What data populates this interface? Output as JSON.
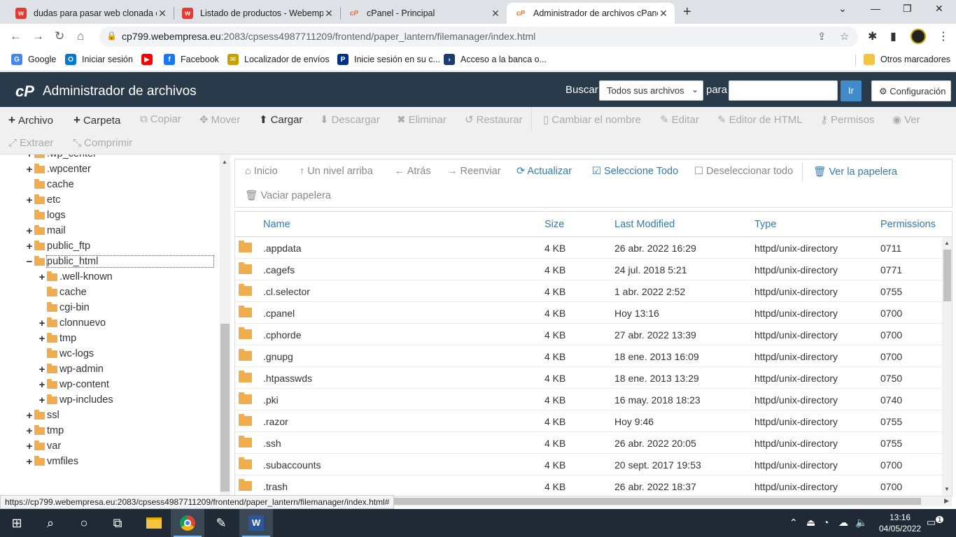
{
  "browser": {
    "tabs": [
      {
        "title": "dudas para pasar web clonada co",
        "favicon_color": "#e53935",
        "favicon_glyph": "w",
        "active": false
      },
      {
        "title": "Listado de productos - Webempr",
        "favicon_color": "#e53935",
        "favicon_glyph": "w",
        "active": false
      },
      {
        "title": "cPanel - Principal",
        "favicon_color": "#ff6c2c",
        "favicon_glyph": "cP",
        "active": false
      },
      {
        "title": "Administrador de archivos cPanel",
        "favicon_color": "#ff6c2c",
        "favicon_glyph": "cP",
        "active": true
      }
    ],
    "url_domain": "cp799.webempresa.eu",
    "url_rest": ":2083/cpsess4987711209/frontend/paper_lantern/filemanager/index.html",
    "bookmarks": [
      {
        "label": "Google",
        "icon_color": "#4285f4",
        "glyph": "G"
      },
      {
        "label": "Iniciar sesión",
        "icon_color": "#0078d4",
        "glyph": "O"
      },
      {
        "label": "",
        "icon_color": "#ff0000",
        "glyph": "▶"
      },
      {
        "label": "Facebook",
        "icon_color": "#1877f2",
        "glyph": "f"
      },
      {
        "label": "Localizador de envíos",
        "icon_color": "#c8a000",
        "glyph": "✉"
      },
      {
        "label": "Inicie sesión en su c...",
        "icon_color": "#003087",
        "glyph": "P"
      },
      {
        "label": "Acceso a la banca o...",
        "icon_color": "#1c3c6e",
        "glyph": "›"
      }
    ],
    "other_bookmarks": "Otros marcadores"
  },
  "header": {
    "logo": "cP",
    "title": "Administrador de archivos",
    "search_label": "Buscar",
    "search_scope": "Todos sus archivos",
    "for_label": "para",
    "go_label": "Ir",
    "settings_label": "Configuración"
  },
  "toolbar": [
    {
      "label": "Archivo",
      "icon": "+",
      "enabled": true
    },
    {
      "label": "Carpeta",
      "icon": "+",
      "enabled": true
    },
    {
      "label": "Copiar",
      "icon": "⧉",
      "enabled": false
    },
    {
      "label": "Mover",
      "icon": "✥",
      "enabled": false
    },
    {
      "label": "Cargar",
      "icon": "⬆",
      "enabled": true
    },
    {
      "label": "Descargar",
      "icon": "⬇",
      "enabled": false
    },
    {
      "label": "Eliminar",
      "icon": "✖",
      "enabled": false
    },
    {
      "label": "Restaurar",
      "icon": "↺",
      "enabled": false
    },
    {
      "label": "Cambiar el nombre",
      "icon": "▯",
      "enabled": false
    },
    {
      "label": "Editar",
      "icon": "✎",
      "enabled": false
    },
    {
      "label": "Editor de HTML",
      "icon": "✎",
      "enabled": false
    },
    {
      "label": "Permisos",
      "icon": "⚷",
      "enabled": false
    },
    {
      "label": "Ver",
      "icon": "◉",
      "enabled": false
    },
    {
      "label": "Extraer",
      "icon": "⤢",
      "enabled": false
    },
    {
      "label": "Comprimir",
      "icon": "⤡",
      "enabled": false
    }
  ],
  "tree": [
    {
      "label": ".wp_center",
      "toggle": "+",
      "depth": 0
    },
    {
      "label": ".wpcenter",
      "toggle": "+",
      "depth": 0
    },
    {
      "label": "cache",
      "toggle": "",
      "depth": 0
    },
    {
      "label": "etc",
      "toggle": "+",
      "depth": 0
    },
    {
      "label": "logs",
      "toggle": "",
      "depth": 0
    },
    {
      "label": "mail",
      "toggle": "+",
      "depth": 0
    },
    {
      "label": "public_ftp",
      "toggle": "+",
      "depth": 0
    },
    {
      "label": "public_html",
      "toggle": "−",
      "depth": 0,
      "selected": true
    },
    {
      "label": ".well-known",
      "toggle": "+",
      "depth": 1
    },
    {
      "label": "cache",
      "toggle": "",
      "depth": 1
    },
    {
      "label": "cgi-bin",
      "toggle": "",
      "depth": 1
    },
    {
      "label": "clonnuevo",
      "toggle": "+",
      "depth": 1
    },
    {
      "label": "tmp",
      "toggle": "+",
      "depth": 1
    },
    {
      "label": "wc-logs",
      "toggle": "",
      "depth": 1
    },
    {
      "label": "wp-admin",
      "toggle": "+",
      "depth": 1
    },
    {
      "label": "wp-content",
      "toggle": "+",
      "depth": 1
    },
    {
      "label": "wp-includes",
      "toggle": "+",
      "depth": 1
    },
    {
      "label": "ssl",
      "toggle": "+",
      "depth": 0
    },
    {
      "label": "tmp",
      "toggle": "+",
      "depth": 0
    },
    {
      "label": "var",
      "toggle": "+",
      "depth": 0
    },
    {
      "label": "vmfiles",
      "toggle": "+",
      "depth": 0
    }
  ],
  "filenav": [
    {
      "label": "Inicio",
      "icon": "⌂",
      "enabled": false
    },
    {
      "label": "Un nivel arriba",
      "icon": "↑",
      "enabled": false
    },
    {
      "label": "Atrás",
      "icon": "←",
      "enabled": false
    },
    {
      "label": "Reenviar",
      "icon": "→",
      "enabled": false
    },
    {
      "label": "Actualizar",
      "icon": "⟳",
      "enabled": true
    },
    {
      "label": "Seleccione Todo",
      "icon": "☑",
      "enabled": true
    },
    {
      "label": "Deseleccionar todo",
      "icon": "☐",
      "enabled": false
    },
    {
      "label": "Ver la papelera",
      "icon": "🗑",
      "enabled": true
    },
    {
      "label": "Vaciar papelera",
      "icon": "🗑",
      "enabled": false
    }
  ],
  "table": {
    "columns": [
      "Name",
      "Size",
      "Last Modified",
      "Type",
      "Permissions"
    ],
    "rows": [
      [
        ".appdata",
        "4 KB",
        "26 abr. 2022 16:29",
        "httpd/unix-directory",
        "0711"
      ],
      [
        ".cagefs",
        "4 KB",
        "24 jul. 2018 5:21",
        "httpd/unix-directory",
        "0771"
      ],
      [
        ".cl.selector",
        "4 KB",
        "1 abr. 2022 2:52",
        "httpd/unix-directory",
        "0755"
      ],
      [
        ".cpanel",
        "4 KB",
        "Hoy 13:16",
        "httpd/unix-directory",
        "0700"
      ],
      [
        ".cphorde",
        "4 KB",
        "27 abr. 2022 13:39",
        "httpd/unix-directory",
        "0700"
      ],
      [
        ".gnupg",
        "4 KB",
        "18 ene. 2013 16:09",
        "httpd/unix-directory",
        "0700"
      ],
      [
        ".htpasswds",
        "4 KB",
        "18 ene. 2013 13:29",
        "httpd/unix-directory",
        "0750"
      ],
      [
        ".pki",
        "4 KB",
        "16 may. 2018 18:23",
        "httpd/unix-directory",
        "0740"
      ],
      [
        ".razor",
        "4 KB",
        "Hoy 9:46",
        "httpd/unix-directory",
        "0755"
      ],
      [
        ".ssh",
        "4 KB",
        "26 abr. 2022 20:05",
        "httpd/unix-directory",
        "0755"
      ],
      [
        ".subaccounts",
        "4 KB",
        "20 sept. 2017 19:53",
        "httpd/unix-directory",
        "0700"
      ],
      [
        ".trash",
        "4 KB",
        "26 abr. 2022 18:37",
        "httpd/unix-directory",
        "0700"
      ]
    ]
  },
  "status_url": "https://cp799.webempresa.eu:2083/cpsess4987711209/frontend/paper_lantern/filemanager/index.html#",
  "taskbar": {
    "time": "13:16",
    "date": "04/05/2022",
    "notifications": "1"
  }
}
